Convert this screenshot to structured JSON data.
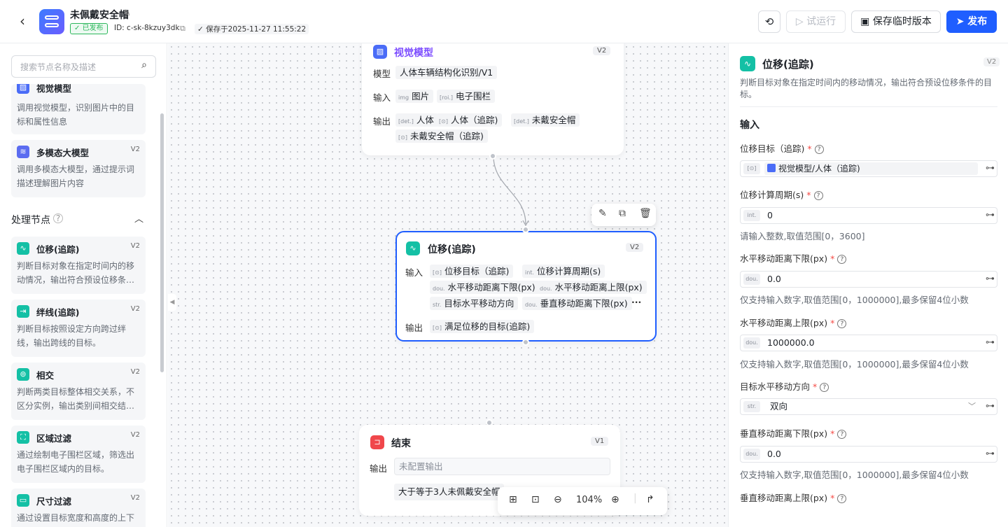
{
  "header": {
    "app_title": "未佩戴安全帽",
    "status_badge": "已发布",
    "app_id": "ID: c-sk-8kzuy3dk",
    "saved_at": "保存于2025-11-27 11:55:22",
    "btn_run": "试运行",
    "btn_save": "保存临时版本",
    "btn_publish": "发布"
  },
  "left": {
    "search_placeholder": "搜索节点名称及描述",
    "top_cards": [
      {
        "name": "视觉模型",
        "desc": "调用视觉模型，识别图片中的目标和属性信息"
      },
      {
        "name": "多模态大模型",
        "version": "V2",
        "desc": "调用多模态大模型，通过提示词描述理解图片内容"
      }
    ],
    "section_title": "处理节点",
    "cards": [
      {
        "name": "位移(追踪)",
        "version": "V2",
        "desc": "判断目标对象在指定时间内的移动情况，输出符合预设位移条…",
        "color": "#14c0a5"
      },
      {
        "name": "绊线(追踪)",
        "version": "V2",
        "desc": "判断目标按照设定方向跨过绊线，输出跨线的目标。",
        "color": "#14c0a5"
      },
      {
        "name": "相交",
        "version": "V2",
        "desc": "判断两类目标整体相交关系，不区分实例，输出类别间相交结…",
        "color": "#14c0a5"
      },
      {
        "name": "区域过滤",
        "version": "V2",
        "desc": "通过绘制电子围栏区域，筛选出电子围栏区域内的目标。",
        "color": "#14c0a5"
      },
      {
        "name": "尺寸过滤",
        "version": "V2",
        "desc": "通过设置目标宽度和高度的上下",
        "color": "#14c0a5"
      }
    ]
  },
  "canvas": {
    "vision_node": {
      "title": "视觉模型",
      "version": "V2",
      "model_label": "模型",
      "model_value": "人体车辆结构化识别/V1",
      "input_label": "输入",
      "inputs": [
        {
          "tag": "img",
          "text": "图片"
        },
        {
          "tag": "[roi.]",
          "text": "电子围栏"
        }
      ],
      "output_label": "输出",
      "outputs": [
        {
          "tag": "[det.]",
          "text": "人体"
        },
        {
          "tag": "[⊙]",
          "text": "人体（追踪)"
        },
        {
          "tag": "[det.]",
          "text": "未戴安全帽"
        },
        {
          "tag": "[⊙]",
          "text": "未戴安全帽（追踪)"
        }
      ]
    },
    "disp_node": {
      "title": "位移(追踪)",
      "version": "V2",
      "input_label": "输入",
      "inputs": [
        {
          "tag": "[⊙]",
          "text": "位移目标（追踪)"
        },
        {
          "tag": "int.",
          "text": "位移计算周期(s)"
        },
        {
          "tag": "dou.",
          "text": "水平移动距离下限(px)"
        },
        {
          "tag": "dou.",
          "text": "水平移动距离上限(px)"
        },
        {
          "tag": "str.",
          "text": "目标水平移动方向"
        },
        {
          "tag": "dou.",
          "text": "垂直移动距离下限(px)"
        }
      ],
      "more": "···",
      "output_label": "输出",
      "output": {
        "tag": "[⊙]",
        "text": "满足位移的目标(追踪)"
      }
    },
    "end_node": {
      "title": "结束",
      "version": "V1",
      "output_label": "输出",
      "output_placeholder": "未配置输出",
      "text_value": "大于等于3人未佩戴安全帽"
    },
    "zoom_level": "104%"
  },
  "panel": {
    "title": "位移(追踪)",
    "version": "V2",
    "desc": "判断目标对象在指定时间内的移动情况，输出符合预设位移条件的目标。",
    "section": "输入",
    "fields": [
      {
        "label": "位移目标（追踪)",
        "tag": "[⊙]",
        "value": "视觉模型/人体（追踪)",
        "hint": ""
      },
      {
        "label": "位移计算周期(s)",
        "tag": "int.",
        "value": "0",
        "hint": "请输入整数,取值范围[0，3600]"
      },
      {
        "label": "水平移动距离下限(px)",
        "tag": "dou.",
        "value": "0.0",
        "hint": "仅支持输入数字,取值范围[0，1000000],最多保留4位小数"
      },
      {
        "label": "水平移动距离上限(px)",
        "tag": "dou.",
        "value": "1000000.0",
        "hint": "仅支持输入数字,取值范围[0，1000000],最多保留4位小数"
      },
      {
        "label": "目标水平移动方向",
        "tag": "str.",
        "value": "双向",
        "hint": ""
      },
      {
        "label": "垂直移动距离下限(px)",
        "tag": "dou.",
        "value": "0.0",
        "hint": "仅支持输入数字,取值范围[0，1000000],最多保留4位小数"
      },
      {
        "label": "垂直移动距离上限(px)",
        "tag": "",
        "value": "",
        "hint": ""
      }
    ]
  }
}
